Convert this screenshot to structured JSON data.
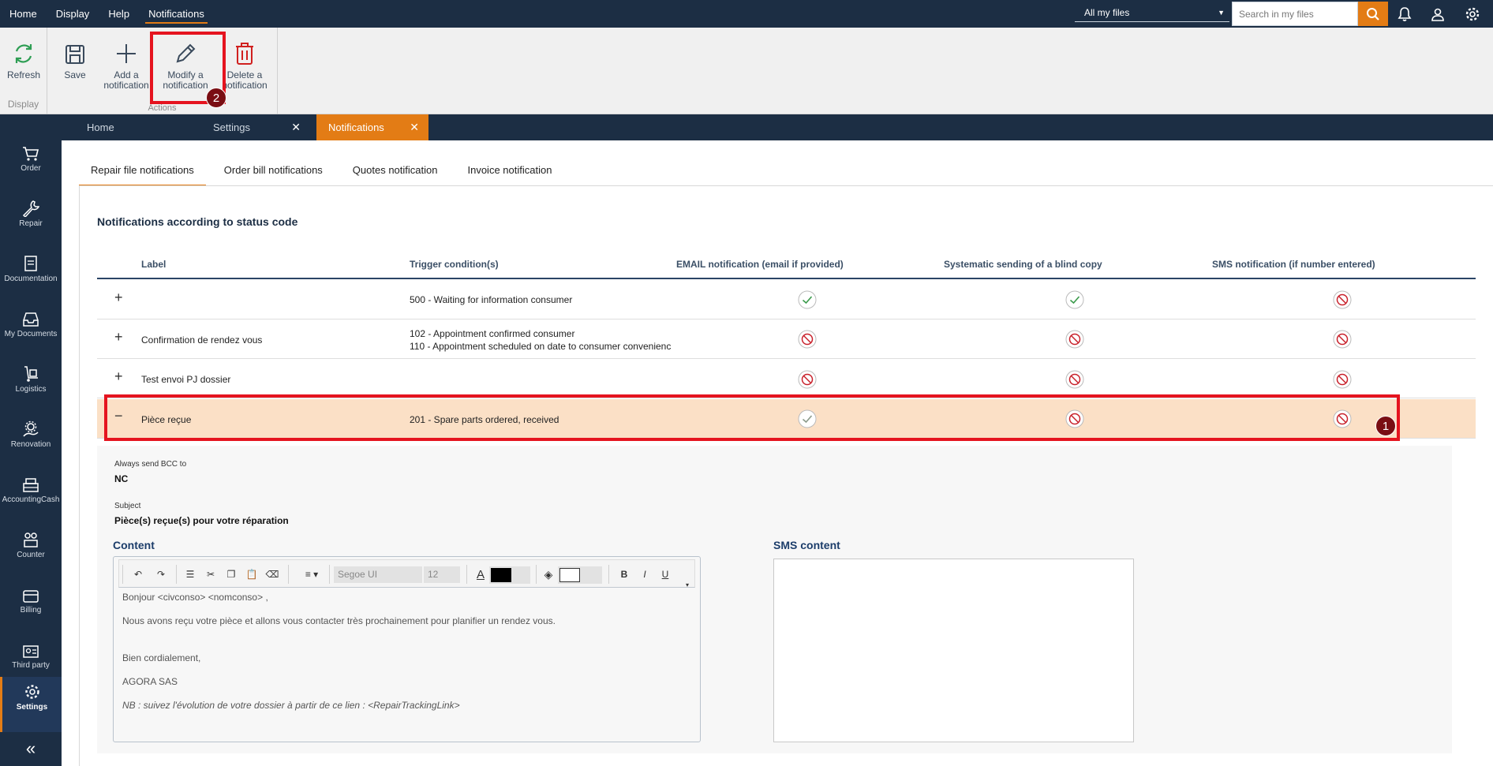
{
  "topmenu": {
    "items": [
      "Home",
      "Display",
      "Help",
      "Notifications"
    ]
  },
  "search": {
    "scope": "All my files",
    "placeholder": "Search in my files"
  },
  "ribbon": {
    "refresh": "Refresh",
    "save": "Save",
    "add": [
      "Add a",
      "notification"
    ],
    "modify": [
      "Modify a",
      "notification"
    ],
    "delete": [
      "Delete a",
      "notification"
    ],
    "display_group": "Display",
    "actions_group": "Actions"
  },
  "annotations": {
    "step1": "1",
    "step2": "2"
  },
  "tabs": {
    "home": "Home",
    "settings": "Settings",
    "notifications": "Notifications",
    "close": "✕"
  },
  "sidebar": {
    "items": [
      {
        "label": "Order"
      },
      {
        "label": "Repair"
      },
      {
        "label": "Documentation"
      },
      {
        "label": "My Documents"
      },
      {
        "label": "Logistics"
      },
      {
        "label": "Renovation"
      },
      {
        "label": "AccountingCash"
      },
      {
        "label": "Counter"
      },
      {
        "label": "Billing"
      },
      {
        "label": "Third party"
      },
      {
        "label": "Settings"
      }
    ],
    "collapse": "«"
  },
  "subtabs": [
    "Repair file notifications",
    "Order bill notifications",
    "Quotes notification",
    "Invoice notification"
  ],
  "section_title": "Notifications according to status code",
  "table": {
    "headers": [
      "Label",
      "Trigger condition(s)",
      "EMAIL notification (email if provided)",
      "Systematic sending of a blind copy",
      "SMS notification (if number entered)"
    ],
    "rows": [
      {
        "toggle": "+",
        "label": "",
        "trigger1": "500 - Waiting for information consumer",
        "trigger2": "",
        "email": "on",
        "bcc": "on",
        "sms": "off"
      },
      {
        "toggle": "+",
        "label": "Confirmation de rendez vous",
        "trigger1": "102 - Appointment confirmed consumer",
        "trigger2": "110 - Appointment scheduled on date to consumer convenienc",
        "email": "off",
        "bcc": "off",
        "sms": "off"
      },
      {
        "toggle": "+",
        "label": "Test envoi PJ dossier",
        "trigger1": "",
        "trigger2": "",
        "email": "off",
        "bcc": "off",
        "sms": "off"
      },
      {
        "toggle": "−",
        "label": "Pièce reçue",
        "trigger1": "201 - Spare parts ordered, received",
        "trigger2": "",
        "email": "on",
        "bcc": "off",
        "sms": "off"
      }
    ]
  },
  "detail": {
    "bcc_label": "Always send BCC to",
    "bcc_value": "NC",
    "subject_label": "Subject",
    "subject_value": "Pièce(s) reçue(s) pour votre réparation",
    "content_title": "Content",
    "sms_title": "SMS content",
    "font_name": "Segoe UI",
    "font_size": "12",
    "body_lines": [
      "Bonjour <civconso> <nomconso> ,",
      "Nous avons reçu votre pièce et allons vous contacter très prochainement pour planifier un rendez vous.",
      "Bien cordialement,",
      "AGORA SAS",
      "NB : suivez l'évolution de votre dossier à partir de ce lien : <RepairTrackingLink>"
    ]
  },
  "colors": {
    "navy": "#1c2e44",
    "accent": "#e37c15",
    "highlight": "#e5141f",
    "expanded_row": "#fbe0c6"
  }
}
